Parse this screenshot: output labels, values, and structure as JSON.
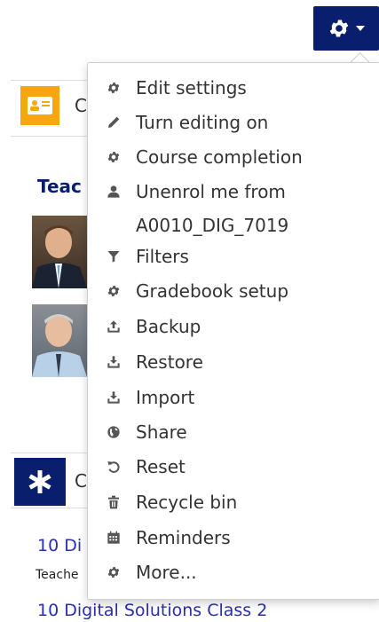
{
  "header": {
    "gear_icon": "gear-icon"
  },
  "blocks": {
    "block1_initial": "C",
    "block2_initial": "C",
    "teachers_heading": "Teac",
    "teacher_text": "Teache",
    "course_link_1": "10 Di",
    "course_link_2": "10 Digital Solutions Class 2"
  },
  "menu": {
    "items": [
      {
        "label": "Edit settings",
        "icon": "gear-icon"
      },
      {
        "label": "Turn editing on",
        "icon": "pencil-icon"
      },
      {
        "label": "Course completion",
        "icon": "gear-icon"
      },
      {
        "label": "Unenrol me from",
        "icon": "user-icon"
      },
      {
        "label": "Filters",
        "icon": "filter-icon"
      },
      {
        "label": "Gradebook setup",
        "icon": "gear-icon"
      },
      {
        "label": "Backup",
        "icon": "upload-icon"
      },
      {
        "label": "Restore",
        "icon": "download-icon"
      },
      {
        "label": "Import",
        "icon": "download-icon"
      },
      {
        "label": "Share",
        "icon": "globe-icon"
      },
      {
        "label": "Reset",
        "icon": "reset-icon"
      },
      {
        "label": "Recycle bin",
        "icon": "trash-icon"
      },
      {
        "label": "Reminders",
        "icon": "calendar-icon"
      },
      {
        "label": "More...",
        "icon": "gear-icon"
      }
    ],
    "unenrol_course": "A0010_DIG_7019"
  },
  "colors": {
    "brand": "#0a1e6e",
    "accent": "#f5a70c",
    "link": "#2a2fb0"
  }
}
